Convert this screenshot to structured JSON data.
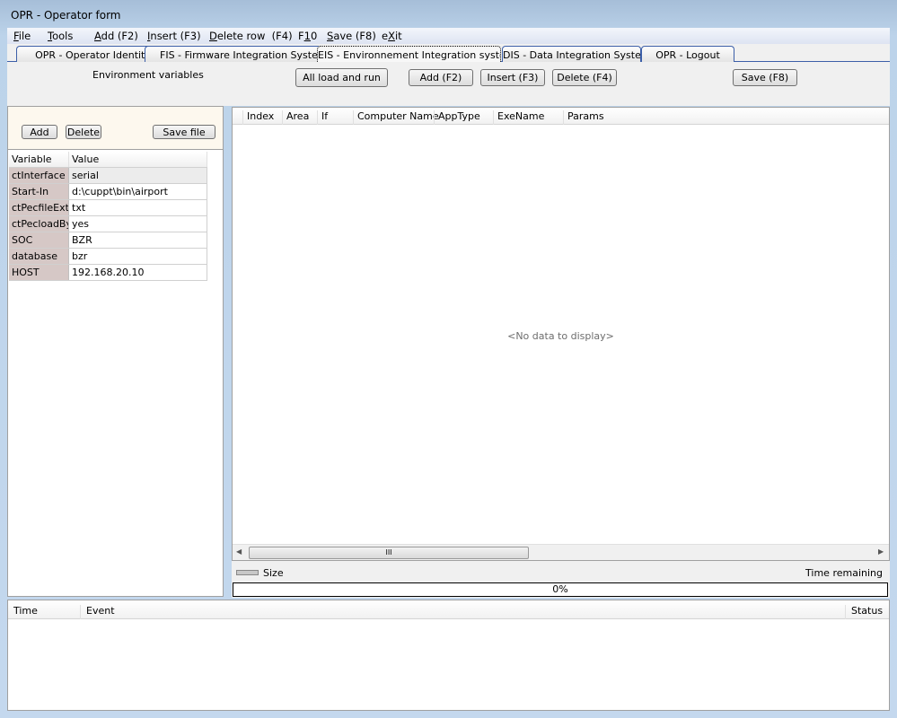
{
  "window": {
    "title": "OPR - Operator form"
  },
  "menu": [
    {
      "label": "File",
      "key": "F",
      "rest": "ile"
    },
    {
      "label": "Tools",
      "key": "T",
      "rest": "ools"
    },
    {
      "label": "Add (F2)",
      "key": "A",
      "rest": "dd (F2)"
    },
    {
      "label": "Insert (F3)",
      "key": "I",
      "rest": "nsert (F3)"
    },
    {
      "label": "Delete row  (F4)",
      "key": "D",
      "rest": "elete row  (F4)"
    },
    {
      "label": "F10",
      "key": "1",
      "pre": "F",
      "rest": "0"
    },
    {
      "label": "Save (F8)",
      "key": "S",
      "rest": "ave (F8)"
    },
    {
      "label": "eXit",
      "key": "X",
      "pre": "e",
      "rest": "it"
    }
  ],
  "tabs": [
    {
      "label": "OPR - Operator Identity",
      "active": false
    },
    {
      "label": "FIS - Firmware Integration System",
      "active": false
    },
    {
      "label": "EIS - Environnement Integration system",
      "active": true
    },
    {
      "label": "DIS - Data Integration System",
      "active": false
    },
    {
      "label": "OPR - Logout",
      "active": false
    }
  ],
  "toolbar": {
    "section_label": "Environment variables",
    "all_load": "All load and run",
    "add": "Add (F2)",
    "insert": "Insert (F3)",
    "delete": "Delete (F4)",
    "save": "Save (F8)"
  },
  "left": {
    "add": "Add",
    "delete": "Delete",
    "save_file": "Save file",
    "headers": [
      "Variable",
      "Value"
    ],
    "rows": [
      [
        "ctInterface",
        "serial"
      ],
      [
        "Start-In",
        "d:\\cuppt\\bin\\airport"
      ],
      [
        "ctPecfileExtension",
        "txt"
      ],
      [
        "ctPecloadByC",
        "yes"
      ],
      [
        "SOC",
        "BZR"
      ],
      [
        "database",
        "bzr"
      ],
      [
        "HOST",
        "192.168.20.10"
      ]
    ]
  },
  "grid": {
    "columns": [
      "Index",
      "Area",
      "If",
      "Computer Name",
      "AppType",
      "ExeName",
      "Params"
    ],
    "empty_text": "<No data to display>"
  },
  "status": {
    "size_label": "Size",
    "time_remaining_label": "Time remaining",
    "progress_text": "0%",
    "progress_value": 0
  },
  "log": {
    "columns": [
      "Time",
      "Event",
      "Status"
    ]
  }
}
